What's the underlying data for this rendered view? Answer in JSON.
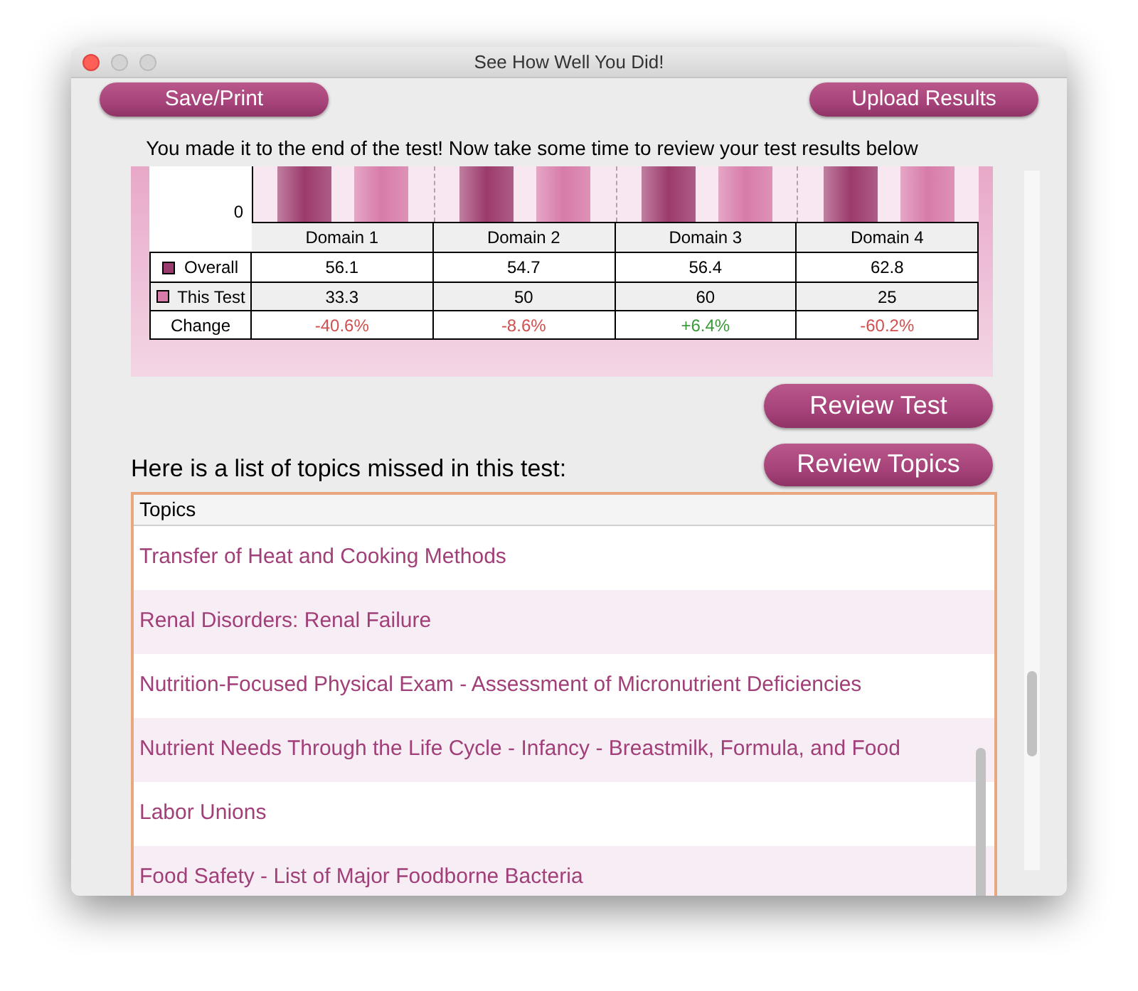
{
  "window": {
    "title": "See How Well You Did!"
  },
  "toolbar": {
    "buttons": [
      "Save/Print",
      "Upload Results"
    ]
  },
  "message": "You made it to the end of the test!  Now take some time to review your test results below",
  "chart": {
    "ytick": "0",
    "table": {
      "columns": [
        "Domain 1",
        "Domain 2",
        "Domain 3",
        "Domain 4"
      ],
      "rows": [
        {
          "kind": "series",
          "label": "Overall",
          "color": "#9b3a6c",
          "cells": [
            {
              "text": "56.1"
            },
            {
              "text": "54.7"
            },
            {
              "text": "56.4"
            },
            {
              "text": "62.8"
            }
          ]
        },
        {
          "kind": "series",
          "label": "This Test",
          "color": "#d77ca9",
          "cells": [
            {
              "text": "33.3"
            },
            {
              "text": "50"
            },
            {
              "text": "60"
            },
            {
              "text": "25"
            }
          ]
        },
        {
          "kind": "change",
          "label": "Change",
          "cells": [
            {
              "text": "-40.6%",
              "color": "#d0504f"
            },
            {
              "text": "-8.6%",
              "color": "#d0504f"
            },
            {
              "text": "+6.4%",
              "color": "#3a9a3a"
            },
            {
              "text": "-60.2%",
              "color": "#d0504f"
            }
          ]
        }
      ]
    }
  },
  "review_buttons": [
    "Review Test",
    "Review Topics"
  ],
  "topics_heading": "Here is a list of topics missed in this test:",
  "topics": {
    "column": "Topics",
    "rows": [
      "Transfer of Heat and Cooking Methods",
      "Renal Disorders:  Renal Failure",
      "Nutrition-Focused Physical Exam - Assessment of Micronutrient Deficiencies",
      "Nutrient Needs Through the Life Cycle - Infancy - Breastmilk, Formula, and Food",
      "Labor Unions",
      "Food Safety - List of Major Foodborne Bacteria"
    ]
  }
}
